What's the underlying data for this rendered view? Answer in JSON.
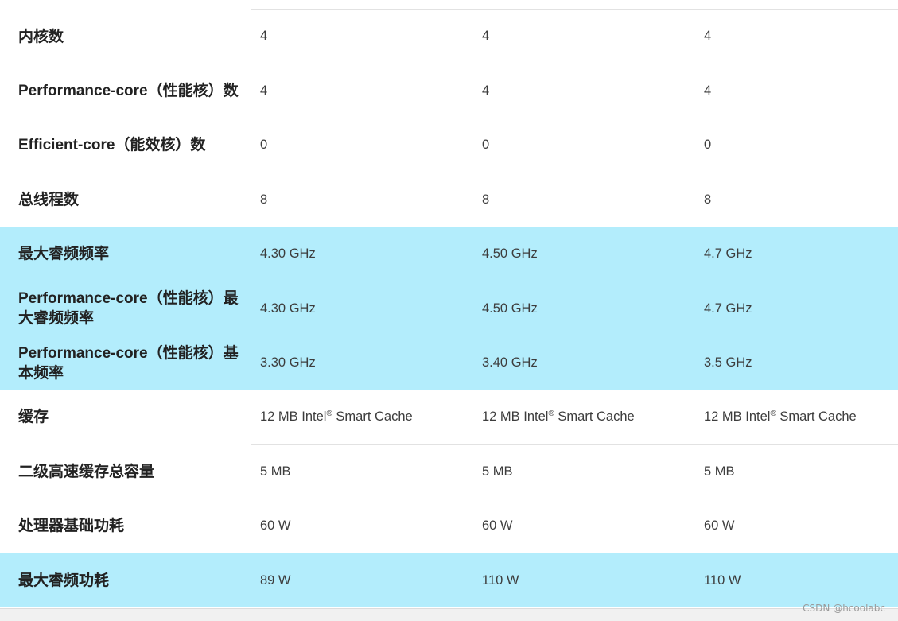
{
  "rows": [
    {
      "label": "内核数",
      "values": [
        "4",
        "4",
        "4"
      ],
      "highlighted": false
    },
    {
      "label": "Performance-core（性能核）数",
      "values": [
        "4",
        "4",
        "4"
      ],
      "highlighted": false
    },
    {
      "label": "Efficient-core（能效核）数",
      "values": [
        "0",
        "0",
        "0"
      ],
      "highlighted": false
    },
    {
      "label": "总线程数",
      "values": [
        "8",
        "8",
        "8"
      ],
      "highlighted": false
    },
    {
      "label": "最大睿频频率",
      "values": [
        "4.30 GHz",
        "4.50 GHz",
        "4.7 GHz"
      ],
      "highlighted": true
    },
    {
      "label": "Performance-core（性能核）最大睿频频率",
      "values": [
        "4.30 GHz",
        "4.50 GHz",
        "4.7 GHz"
      ],
      "highlighted": true
    },
    {
      "label": "Performance-core（性能核）基本频率",
      "values": [
        "3.30 GHz",
        "3.40 GHz",
        "3.5 GHz"
      ],
      "highlighted": true
    },
    {
      "label": "缓存",
      "values": [
        "12 MB Intel® Smart Cache",
        "12 MB Intel® Smart Cache",
        "12 MB Intel® Smart Cache"
      ],
      "highlighted": false
    },
    {
      "label": "二级高速缓存总容量",
      "values": [
        "5 MB",
        "5 MB",
        "5 MB"
      ],
      "highlighted": false
    },
    {
      "label": "处理器基础功耗",
      "values": [
        "60 W",
        "60 W",
        "60 W"
      ],
      "highlighted": false
    },
    {
      "label": "最大睿频功耗",
      "values": [
        "89 W",
        "110 W",
        "110 W"
      ],
      "highlighted": true
    }
  ],
  "watermark": "CSDN @hcoolabc",
  "colors": {
    "highlight": "#b3edfc",
    "divider": "#e2e2e2",
    "label_text": "#222222",
    "value_text": "#3d3d3d"
  }
}
